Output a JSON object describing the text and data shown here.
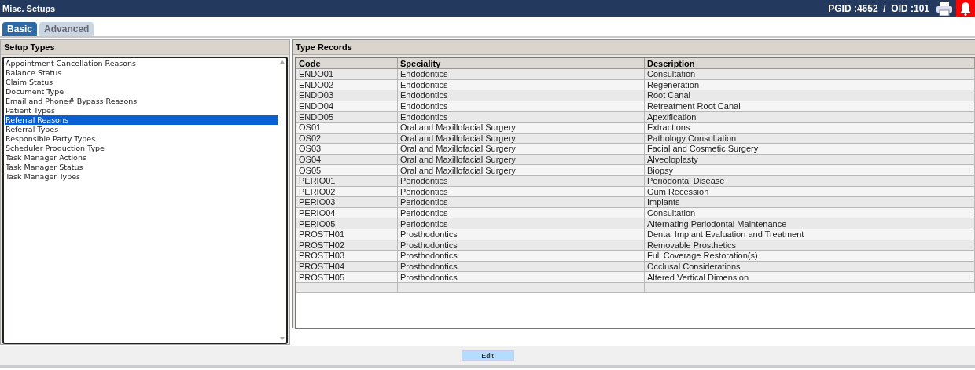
{
  "header": {
    "title": "Misc. Setups",
    "ids": "PGID :4652  /  OID :101"
  },
  "tabs": [
    {
      "label": "Basic",
      "selected": true
    },
    {
      "label": "Advanced",
      "selected": false
    }
  ],
  "setup_types": {
    "title": "Setup Types",
    "items": [
      {
        "label": "Appointment Cancellation Reasons",
        "selected": false
      },
      {
        "label": "Balance Status",
        "selected": false
      },
      {
        "label": "Claim Status",
        "selected": false
      },
      {
        "label": "Document Type",
        "selected": false
      },
      {
        "label": "Email and Phone# Bypass Reasons",
        "selected": false
      },
      {
        "label": "Patient Types",
        "selected": false
      },
      {
        "label": "Referral Reasons",
        "selected": true
      },
      {
        "label": "Referral Types",
        "selected": false
      },
      {
        "label": "Responsible Party Types",
        "selected": false
      },
      {
        "label": "Scheduler Production Type",
        "selected": false
      },
      {
        "label": "Task Manager Actions",
        "selected": false
      },
      {
        "label": "Task Manager Status",
        "selected": false
      },
      {
        "label": "Task Manager Types",
        "selected": false
      }
    ]
  },
  "type_records": {
    "title": "Type Records",
    "columns": [
      "Code",
      "Speciality",
      "Description"
    ],
    "rows": [
      [
        "ENDO01",
        "Endodontics",
        "Consultation"
      ],
      [
        "ENDO02",
        "Endodontics",
        "Regeneration"
      ],
      [
        "ENDO03",
        "Endodontics",
        "Root Canal"
      ],
      [
        "ENDO04",
        "Endodontics",
        "Retreatment Root Canal"
      ],
      [
        "ENDO05",
        "Endodontics",
        "Apexification"
      ],
      [
        "OS01",
        "Oral and Maxillofacial Surgery",
        "Extractions"
      ],
      [
        "OS02",
        "Oral and Maxillofacial Surgery",
        "Pathology Consultation"
      ],
      [
        "OS03",
        "Oral and Maxillofacial Surgery",
        "Facial and Cosmetic Surgery"
      ],
      [
        "OS04",
        "Oral and Maxillofacial Surgery",
        "Alveoloplasty"
      ],
      [
        "OS05",
        "Oral and Maxillofacial Surgery",
        "Biopsy"
      ],
      [
        "PERIO01",
        "Periodontics",
        "Periodontal Disease"
      ],
      [
        "PERIO02",
        "Periodontics",
        "Gum Recession"
      ],
      [
        "PERIO03",
        "Periodontics",
        "Implants"
      ],
      [
        "PERIO04",
        "Periodontics",
        "Consultation"
      ],
      [
        "PERIO05",
        "Periodontics",
        "Alternating Periodontal Maintenance"
      ],
      [
        "PROSTH01",
        "Prosthodontics",
        "Dental Implant Evaluation and Treatment"
      ],
      [
        "PROSTH02",
        "Prosthodontics",
        "Removable Prosthetics"
      ],
      [
        "PROSTH03",
        "Prosthodontics",
        "Full Coverage Restoration(s)"
      ],
      [
        "PROSTH04",
        "Prosthodontics",
        "Occlusal Considerations"
      ],
      [
        "PROSTH05",
        "Prosthodontics",
        "Altered Vertical Dimension"
      ]
    ]
  },
  "buttons": [
    "Edit"
  ]
}
